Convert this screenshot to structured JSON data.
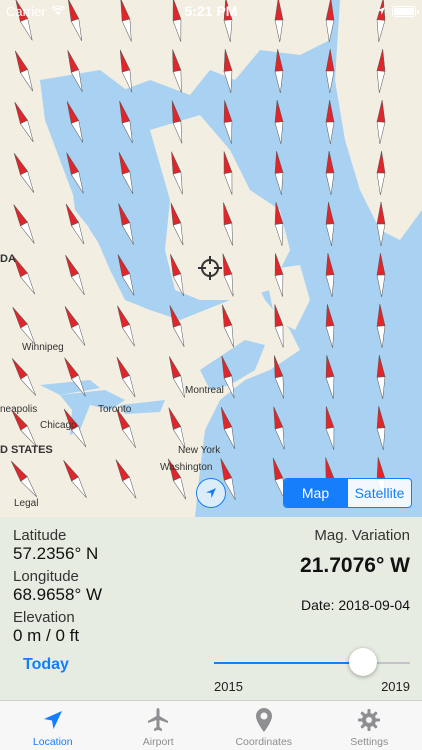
{
  "status_bar": {
    "carrier": "Carrier",
    "time": "5:21 PM"
  },
  "map": {
    "labels": {
      "winnipeg": "Winnipeg",
      "montreal": "Montreal",
      "toronto": "Toronto",
      "chicago": "Chicago",
      "minneapolis": "neapolis",
      "new_york": "New York",
      "washington": "Washington",
      "states": "D STATES",
      "canada": "DA",
      "legal": "Legal"
    },
    "type_control": {
      "options": [
        "Map",
        "Satellite"
      ],
      "selected": "Map"
    }
  },
  "info": {
    "latitude_label": "Latitude",
    "latitude_value": "57.2356° N",
    "longitude_label": "Longitude",
    "longitude_value": "68.9658° W",
    "elevation_label": "Elevation",
    "elevation_value": "0 m /  0 ft",
    "mag_variation_label": "Mag. Variation",
    "mag_variation_value": "21.7076° W",
    "date_text": "Date: 2018-09-04"
  },
  "date_slider": {
    "today_label": "Today",
    "min_label": "2015",
    "max_label": "2019",
    "position_fraction": 0.76
  },
  "tabs": [
    {
      "label": "Location",
      "icon": "location-arrow-icon",
      "active": true
    },
    {
      "label": "Airport",
      "icon": "airplane-icon",
      "active": false
    },
    {
      "label": "Coordinates",
      "icon": "map-pin-icon",
      "active": false
    },
    {
      "label": "Settings",
      "icon": "gear-icon",
      "active": false
    }
  ],
  "colors": {
    "accent": "#147efb",
    "water": "#a9d1f2",
    "land": "#f2eee2",
    "needle_red": "#e0262b"
  }
}
